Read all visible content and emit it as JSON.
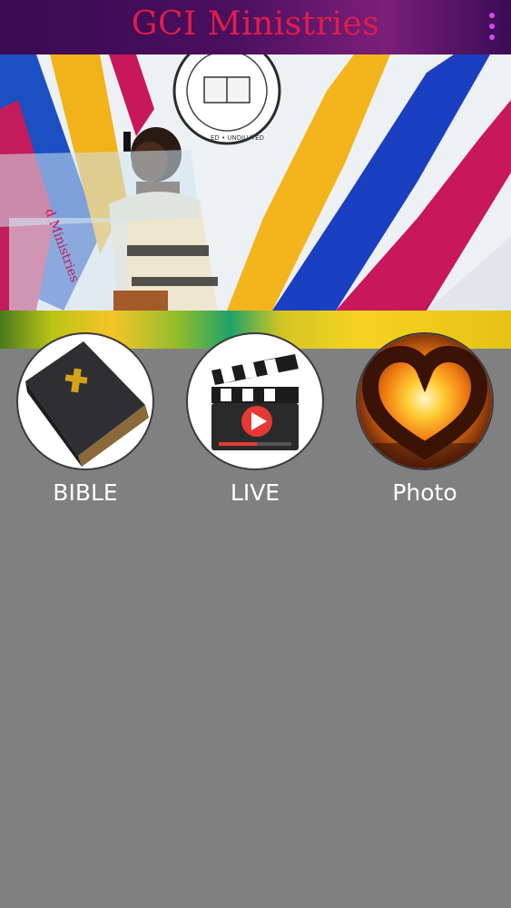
{
  "appbar": {
    "title": "GCI Ministries",
    "menu_icon": "more-vert-icon",
    "colors": {
      "background": "#4a0f5e",
      "title": "#e11d48",
      "menu": "#d946ef"
    }
  },
  "hero": {
    "image_desc_icon": "preacher-banner-image",
    "seal_text": "ED • UNDILUTED",
    "podium_text": "d Ministries"
  },
  "menu": {
    "items": [
      {
        "label": "BIBLE",
        "icon": "bible-book-icon"
      },
      {
        "label": "LIVE",
        "icon": "clapperboard-play-icon"
      },
      {
        "label": "Photo",
        "icon": "heart-hands-sunset-icon"
      }
    ]
  },
  "colors": {
    "page_background": "#808080",
    "tile_label": "#ffffff"
  }
}
